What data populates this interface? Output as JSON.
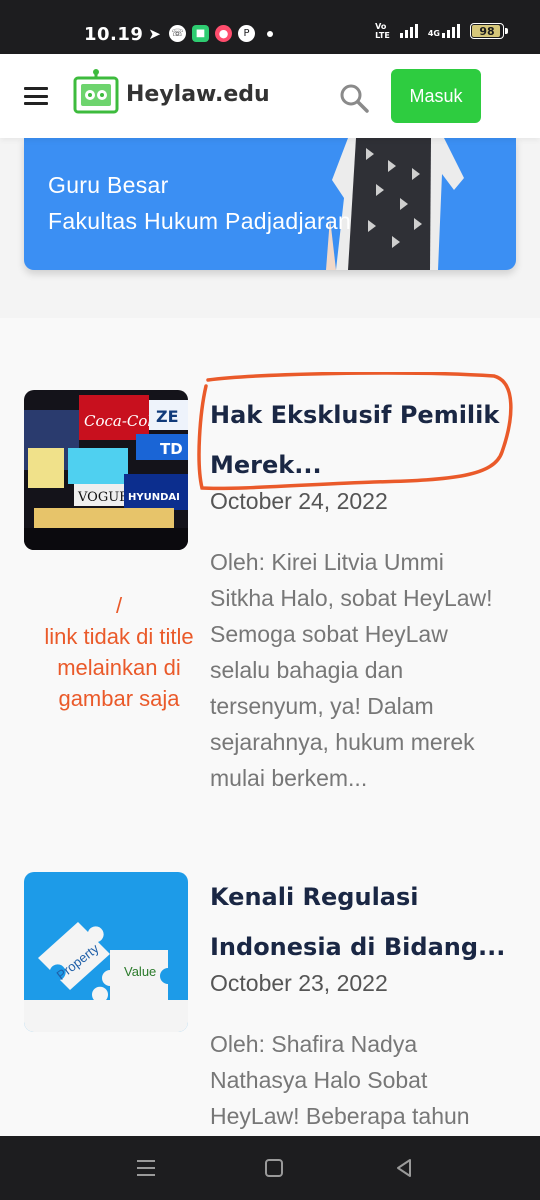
{
  "status_bar": {
    "time": "10.19",
    "battery": "98",
    "volte": [
      "Vo",
      "LTE"
    ],
    "network": "4G"
  },
  "header": {
    "logo_text": "Heylaw.edu",
    "login_label": "Masuk"
  },
  "profile": {
    "line1": "Guru Besar",
    "line2": "Fakultas Hukum Padjadjaran"
  },
  "articles": [
    {
      "title_line1": "Hak Eksklusif Pemilik",
      "title_line2": "Merek...",
      "date": "October 24, 2022",
      "excerpt": "Oleh: Kirei Litvia Ummi Sitkha Halo, sobat HeyLaw! Semoga sobat HeyLaw selalu bahagia dan tersenyum, ya! Dalam sejarahnya, hukum merek mulai berkem...",
      "thumb_signs": [
        "Coca-Cola",
        "ZE",
        "TD",
        "VOGUE",
        "HYUNDAI"
      ]
    },
    {
      "title_line1": "Kenali Regulasi",
      "title_line2": "Indonesia di Bidang...",
      "date": "October 23, 2022",
      "excerpt": "Oleh: Shafira Nadya Nathasya Halo Sobat HeyLaw! Beberapa tahun",
      "thumb_words": [
        "Property",
        "Value"
      ]
    }
  ],
  "annotation": {
    "slash": "/",
    "note": "link tidak di title melainkan di gambar saja",
    "color": "#ea5a2a"
  },
  "colors": {
    "brand_green": "#2ecc40",
    "card_blue": "#3b8ff3",
    "title_navy": "#1a2744"
  }
}
